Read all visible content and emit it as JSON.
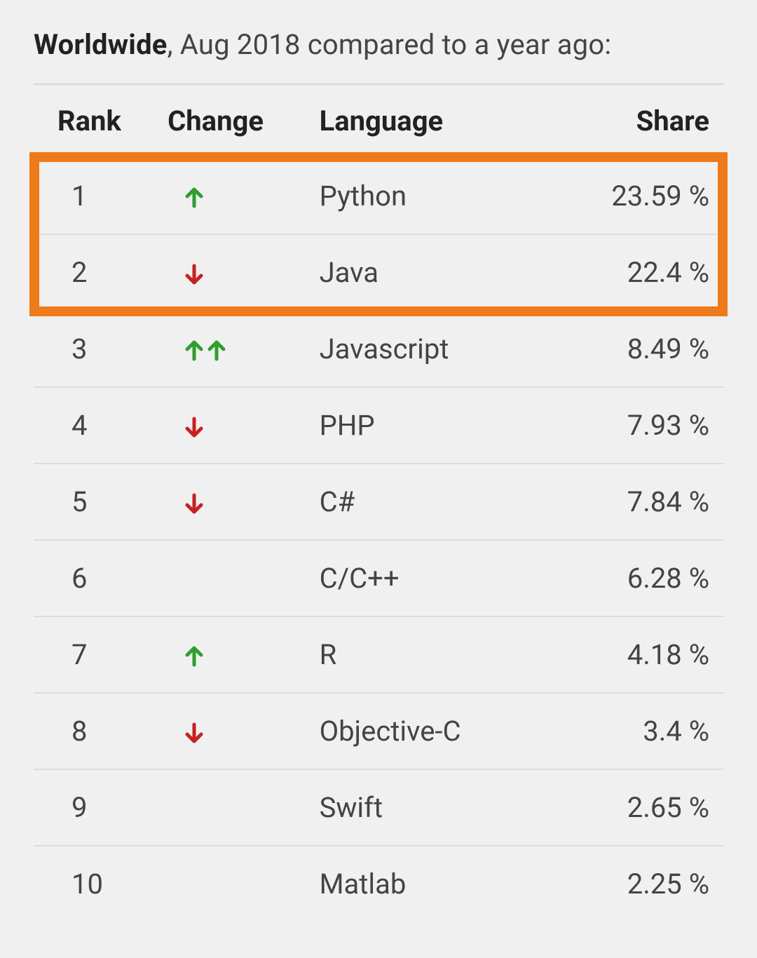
{
  "title": {
    "bold": "Worldwide",
    "rest": ", Aug 2018 compared to a year ago:"
  },
  "headers": {
    "rank": "Rank",
    "change": "Change",
    "language": "Language",
    "share": "Share"
  },
  "rows": [
    {
      "rank": "1",
      "change": "up",
      "language": "Python",
      "share": "23.59 %"
    },
    {
      "rank": "2",
      "change": "down",
      "language": "Java",
      "share": "22.4 %"
    },
    {
      "rank": "3",
      "change": "up2",
      "language": "Javascript",
      "share": "8.49 %"
    },
    {
      "rank": "4",
      "change": "down",
      "language": "PHP",
      "share": "7.93 %"
    },
    {
      "rank": "5",
      "change": "down",
      "language": "C#",
      "share": "7.84 %"
    },
    {
      "rank": "6",
      "change": "",
      "language": "C/C++",
      "share": "6.28 %"
    },
    {
      "rank": "7",
      "change": "up",
      "language": "R",
      "share": "4.18 %"
    },
    {
      "rank": "8",
      "change": "down",
      "language": "Objective-C",
      "share": "3.4 %"
    },
    {
      "rank": "9",
      "change": "",
      "language": "Swift",
      "share": "2.65 %"
    },
    {
      "rank": "10",
      "change": "",
      "language": "Matlab",
      "share": "2.25 %"
    }
  ],
  "highlight_rows": 2,
  "colors": {
    "up": "#2e9e2e",
    "down": "#c62020",
    "highlight_border": "#ee7a1a"
  },
  "chart_data": {
    "type": "table",
    "title": "Worldwide programming language popularity share — Aug 2018 vs a year ago",
    "columns": [
      "Rank",
      "Change",
      "Language",
      "Share (%)"
    ],
    "series": [
      {
        "name": "Share",
        "categories": [
          "Python",
          "Java",
          "Javascript",
          "PHP",
          "C#",
          "C/C++",
          "R",
          "Objective-C",
          "Swift",
          "Matlab"
        ],
        "values": [
          23.59,
          22.4,
          8.49,
          7.93,
          7.84,
          6.28,
          4.18,
          3.4,
          2.65,
          2.25
        ]
      }
    ],
    "rows": [
      {
        "rank": 1,
        "change": "up",
        "language": "Python",
        "share_pct": 23.59
      },
      {
        "rank": 2,
        "change": "down",
        "language": "Java",
        "share_pct": 22.4
      },
      {
        "rank": 3,
        "change": "up up",
        "language": "Javascript",
        "share_pct": 8.49
      },
      {
        "rank": 4,
        "change": "down",
        "language": "PHP",
        "share_pct": 7.93
      },
      {
        "rank": 5,
        "change": "down",
        "language": "C#",
        "share_pct": 7.84
      },
      {
        "rank": 6,
        "change": "none",
        "language": "C/C++",
        "share_pct": 6.28
      },
      {
        "rank": 7,
        "change": "up",
        "language": "R",
        "share_pct": 4.18
      },
      {
        "rank": 8,
        "change": "down",
        "language": "Objective-C",
        "share_pct": 3.4
      },
      {
        "rank": 9,
        "change": "none",
        "language": "Swift",
        "share_pct": 2.65
      },
      {
        "rank": 10,
        "change": "none",
        "language": "Matlab",
        "share_pct": 2.25
      }
    ],
    "ylim": [
      0,
      25
    ]
  }
}
